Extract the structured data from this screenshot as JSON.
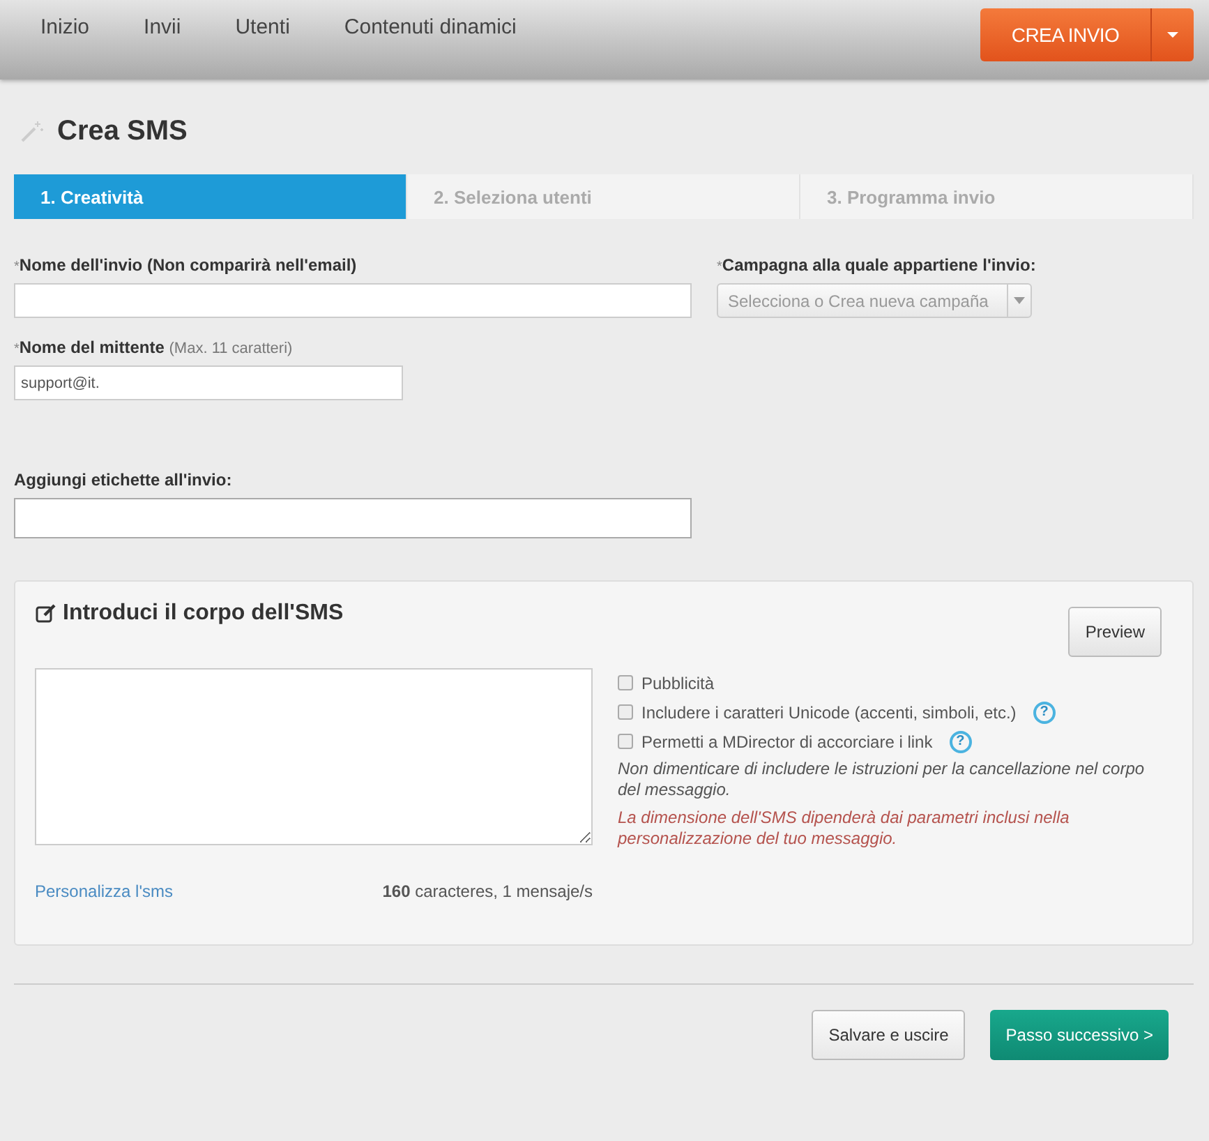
{
  "nav": [
    {
      "label": "Inizio"
    },
    {
      "label": "Invii"
    },
    {
      "label": "Utenti"
    },
    {
      "label": "Contenuti dinamici"
    }
  ],
  "create_button": {
    "label": "CREA INVIO"
  },
  "page_title": "Crea SMS",
  "steps": [
    {
      "label": "1. Creatività",
      "selected": true
    },
    {
      "label": "2. Seleziona utenti",
      "selected": false
    },
    {
      "label": "3. Programma invio",
      "selected": false
    }
  ],
  "name_field": {
    "required_mark": "*",
    "label": "Nome dell'invio (Non comparirà nell'email)"
  },
  "campaign_select": {
    "required_mark": "*",
    "label": "Campagna alla quale appartiene l'invio:",
    "placeholder": "Selecciona o Crea nueva campaña"
  },
  "sender_field": {
    "required_mark": "*",
    "label": "Nome del mittente",
    "hint": "(Max. 11 caratteri)",
    "value": "support@it."
  },
  "tags_field": {
    "label": "Aggiungi etichette all'invio:"
  },
  "sms_panel": {
    "title": "Introduci il corpo dell'SMS",
    "preview_button": "Preview",
    "options": [
      {
        "label": "Pubblicità",
        "checked": false
      },
      {
        "label": "Includere i caratteri Unicode (accenti, simboli, etc.)",
        "checked": false,
        "help_icon": "?"
      },
      {
        "label": "Permetti a MDirector di accorciare i link",
        "checked": false,
        "help_icon": "?"
      }
    ],
    "note": "Non dimenticare di includere le istruzioni per la cancellazione nel corpo del messaggio.",
    "warning": "La dimensione dell'SMS dipenderà dai parametri inclusi nella personalizzazione del tuo messaggio.",
    "personalize_link": "Personalizza l'sms",
    "counter": "**160** caracteres, 1 mensaje/s"
  },
  "footer_buttons": [
    {
      "label": "Salvare e uscire",
      "kind": "secondary"
    },
    {
      "label": "Passo successivo >",
      "kind": "primary"
    }
  ]
}
